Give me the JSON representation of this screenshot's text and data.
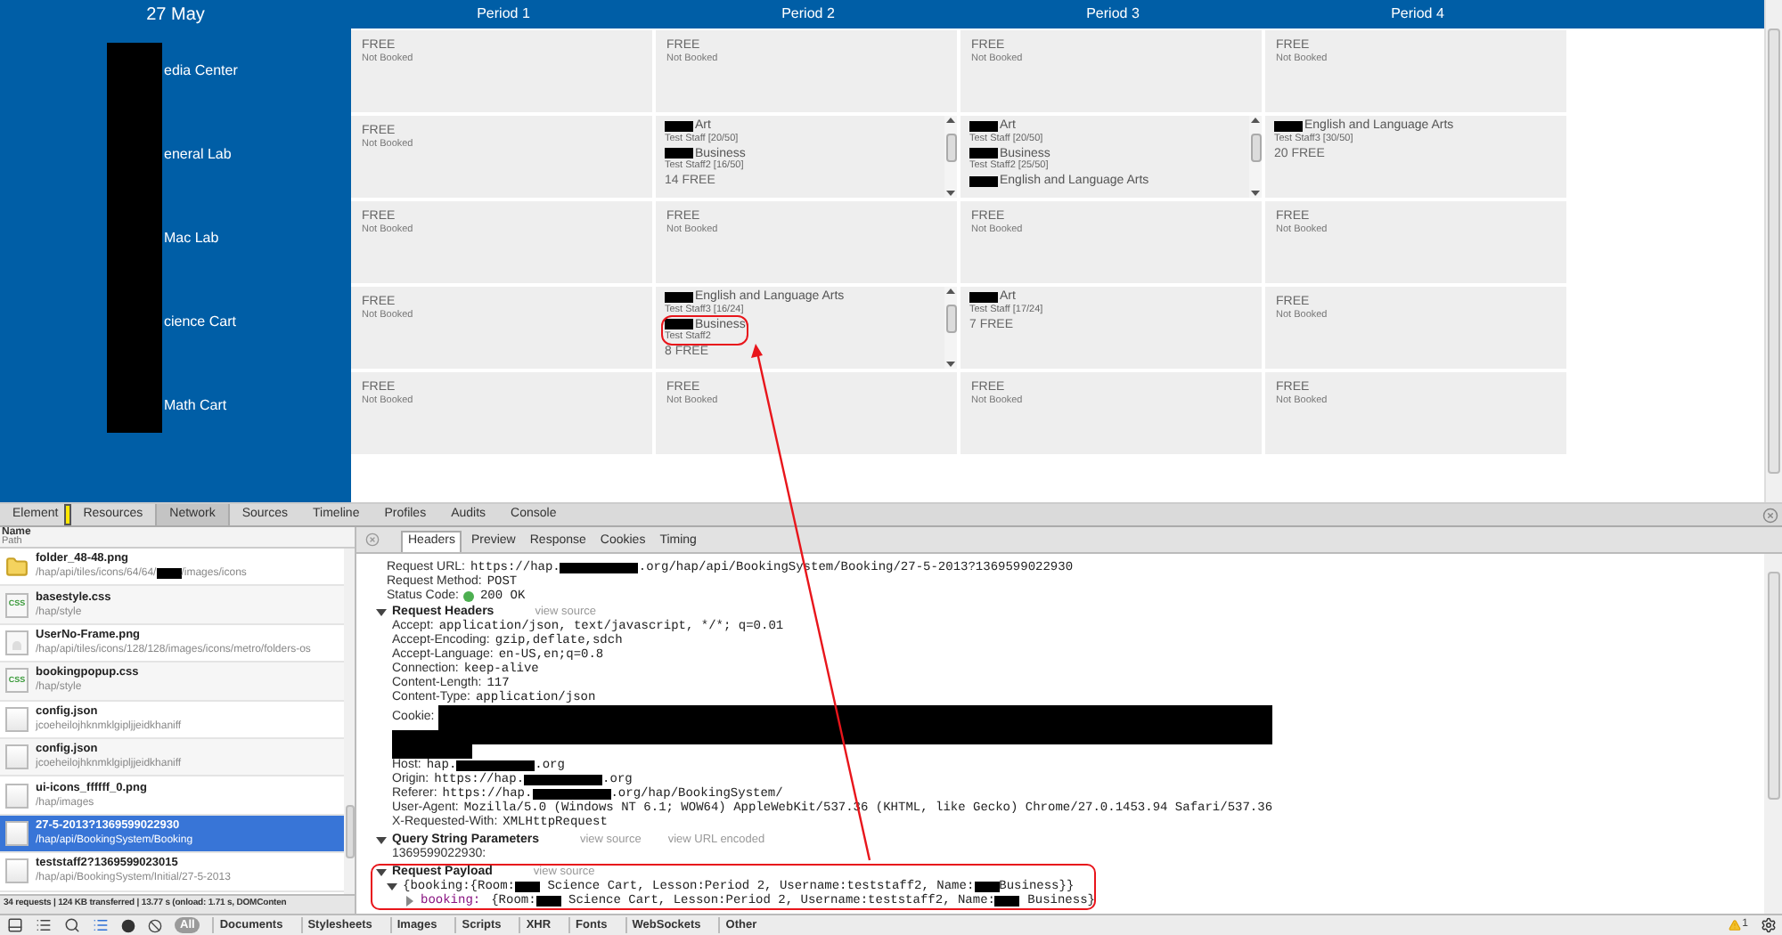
{
  "schedule": {
    "date": "27 May",
    "periods": [
      "Period 1",
      "Period 2",
      "Period 3",
      "Period 4"
    ],
    "rooms": [
      {
        "name": "edia Center",
        "cells": [
          {
            "kind": "free",
            "status": "FREE",
            "note": "Not Booked"
          },
          {
            "kind": "free",
            "status": "FREE",
            "note": "Not Booked"
          },
          {
            "kind": "free",
            "status": "FREE",
            "note": "Not Booked"
          },
          {
            "kind": "free",
            "status": "FREE",
            "note": "Not Booked"
          }
        ]
      },
      {
        "name": "eneral Lab",
        "cells": [
          {
            "kind": "free",
            "status": "FREE",
            "note": "Not Booked"
          },
          {
            "kind": "booked",
            "scrollable": true,
            "bookings": [
              {
                "subject": "Art",
                "staff": "Test Staff [20/50]",
                "highlighted": false
              },
              {
                "subject": "Business",
                "staff": "Test Staff2 [16/50]",
                "highlighted": false
              }
            ],
            "free": "14 FREE"
          },
          {
            "kind": "booked",
            "scrollable": true,
            "bookings": [
              {
                "subject": "Art",
                "staff": "Test Staff [20/50]",
                "highlighted": false
              },
              {
                "subject": "Business",
                "staff": "Test Staff2 [25/50]",
                "highlighted": false
              },
              {
                "subject": "English and Language Arts",
                "highlighted": false
              }
            ]
          },
          {
            "kind": "booked",
            "scrollable": false,
            "bookings": [
              {
                "subject": "English and Language Arts",
                "staff": "Test Staff3 [30/50]",
                "highlighted": false
              }
            ],
            "free": "20 FREE"
          }
        ]
      },
      {
        "name": "Mac Lab",
        "cells": [
          {
            "kind": "free",
            "status": "FREE",
            "note": "Not Booked"
          },
          {
            "kind": "free",
            "status": "FREE",
            "note": "Not Booked"
          },
          {
            "kind": "free",
            "status": "FREE",
            "note": "Not Booked"
          },
          {
            "kind": "free",
            "status": "FREE",
            "note": "Not Booked"
          }
        ]
      },
      {
        "name": "cience Cart",
        "cells": [
          {
            "kind": "free",
            "status": "FREE",
            "note": "Not Booked"
          },
          {
            "kind": "booked",
            "scrollable": true,
            "bookings": [
              {
                "subject": "English and Language Arts",
                "staff": "Test Staff3 [16/24]",
                "highlighted": false
              },
              {
                "subject": "Business",
                "staff": "Test Staff2",
                "highlighted": true
              }
            ],
            "free": "8 FREE"
          },
          {
            "kind": "booked",
            "scrollable": false,
            "bookings": [
              {
                "subject": "Art",
                "staff": "Test Staff [17/24]",
                "highlighted": false
              }
            ],
            "free": "7 FREE"
          },
          {
            "kind": "free",
            "status": "FREE",
            "note": "Not Booked"
          }
        ]
      },
      {
        "name": "Math Cart",
        "cells": [
          {
            "kind": "free",
            "status": "FREE",
            "note": "Not Booked"
          },
          {
            "kind": "free",
            "status": "FREE",
            "note": "Not Booked"
          },
          {
            "kind": "free",
            "status": "FREE",
            "note": "Not Booked"
          },
          {
            "kind": "free",
            "status": "FREE",
            "note": "Not Booked"
          }
        ]
      }
    ]
  },
  "devtools": {
    "tabs": [
      {
        "label": "Element",
        "selected": false
      },
      {
        "label": "Resources",
        "selected": false
      },
      {
        "label": "Network",
        "selected": true
      },
      {
        "label": "Sources",
        "selected": false
      },
      {
        "label": "Timeline",
        "selected": false
      },
      {
        "label": "Profiles",
        "selected": false
      },
      {
        "label": "Audits",
        "selected": false
      },
      {
        "label": "Console",
        "selected": false
      }
    ],
    "request_list": {
      "header": "Name",
      "subheader": "Path",
      "items": [
        {
          "name": "folder_48-48.png",
          "path_parts": [
            "/hap/api/tiles/icons/64/64/",
            "/images/icons"
          ],
          "kind": "folder",
          "selected": false
        },
        {
          "name": "basestyle.css",
          "path_parts": [
            "/hap/style"
          ],
          "kind": "css",
          "icon_text": "CSS",
          "selected": false
        },
        {
          "name": "UserNo-Frame.png",
          "path_parts": [
            "/hap/api/tiles/icons/128/128/images/icons/metro/folders-os"
          ],
          "kind": "image",
          "selected": false
        },
        {
          "name": "bookingpopup.css",
          "path_parts": [
            "/hap/style"
          ],
          "kind": "css",
          "icon_text": "CSS",
          "selected": false
        },
        {
          "name": "config.json",
          "path_parts": [
            "jcoeheilojhknmklgipljjeidkhaniff"
          ],
          "kind": "blank",
          "selected": false
        },
        {
          "name": "config.json",
          "path_parts": [
            "jcoeheilojhknmklgipljjeidkhaniff"
          ],
          "kind": "blank",
          "selected": false
        },
        {
          "name": "ui-icons_ffffff_0.png",
          "path_parts": [
            "/hap/images"
          ],
          "kind": "blank",
          "selected": false
        },
        {
          "name": "27-5-2013?1369599022930",
          "path_parts": [
            "/hap/api/BookingSystem/Booking"
          ],
          "kind": "blank",
          "selected": true
        },
        {
          "name": "teststaff2?1369599023015",
          "path_parts": [
            "/hap/api/BookingSystem/Initial/27-5-2013"
          ],
          "kind": "blank",
          "selected": false
        }
      ],
      "summary": "34 requests | 124 KB transferred | 13.77 s (onload: 1.71 s, DOMConten"
    },
    "filter_bar": {
      "filters": [
        {
          "label": "All",
          "selected": true
        },
        {
          "label": "Documents",
          "selected": false
        },
        {
          "label": "Stylesheets",
          "selected": false
        },
        {
          "label": "Images",
          "selected": false
        },
        {
          "label": "Scripts",
          "selected": false
        },
        {
          "label": "XHR",
          "selected": false
        },
        {
          "label": "Fonts",
          "selected": false
        },
        {
          "label": "WebSockets",
          "selected": false
        },
        {
          "label": "Other",
          "selected": false
        }
      ],
      "warnings": "1"
    },
    "detail": {
      "tabs": [
        {
          "label": "Headers",
          "selected": true
        },
        {
          "label": "Preview",
          "selected": false
        },
        {
          "label": "Response",
          "selected": false
        },
        {
          "label": "Cookies",
          "selected": false
        },
        {
          "label": "Timing",
          "selected": false
        }
      ],
      "general": [
        {
          "name": "Request URL:",
          "kind": "text",
          "parts": [
            "https://hap.",
            ".org/hap/api/BookingSystem/Booking/27-5-2013?1369599022930"
          ]
        },
        {
          "name": "Request Method:",
          "kind": "text",
          "parts": [
            "POST"
          ]
        },
        {
          "name": "Status Code:",
          "kind": "status",
          "parts": [
            "200 OK"
          ]
        }
      ],
      "sections": [
        {
          "title": "Request Headers",
          "expanded": true,
          "highlighted": false,
          "links": [
            "view source"
          ],
          "rows": [
            {
              "name": "Accept:",
              "kind": "text",
              "parts": [
                "application/json, text/javascript, */*; q=0.01"
              ]
            },
            {
              "name": "Accept-Encoding:",
              "kind": "text",
              "parts": [
                "gzip,deflate,sdch"
              ]
            },
            {
              "name": "Accept-Language:",
              "kind": "text",
              "parts": [
                "en-US,en;q=0.8"
              ]
            },
            {
              "name": "Connection:",
              "kind": "text",
              "parts": [
                "keep-alive"
              ]
            },
            {
              "name": "Content-Length:",
              "kind": "text",
              "parts": [
                "117"
              ]
            },
            {
              "name": "Content-Type:",
              "kind": "text",
              "parts": [
                "application/json"
              ]
            },
            {
              "name": "Cookie:",
              "kind": "redacted"
            },
            {
              "name": "Host:",
              "kind": "text",
              "parts": [
                "hap.",
                ".org"
              ]
            },
            {
              "name": "Origin:",
              "kind": "text",
              "parts": [
                "https://hap.",
                ".org"
              ]
            },
            {
              "name": "Referer:",
              "kind": "text",
              "parts": [
                "https://hap.",
                ".org/hap/BookingSystem/"
              ]
            },
            {
              "name": "User-Agent:",
              "kind": "text",
              "parts": [
                "Mozilla/5.0 (Windows NT 6.1; WOW64) AppleWebKit/537.36 (KHTML, like Gecko) Chrome/27.0.1453.94 Safari/537.36"
              ]
            },
            {
              "name": "X-Requested-With:",
              "kind": "text",
              "parts": [
                "XMLHttpRequest"
              ]
            }
          ]
        },
        {
          "title": "Query String Parameters",
          "expanded": true,
          "highlighted": false,
          "links": [
            "view source",
            "view URL encoded"
          ],
          "rows": [
            {
              "name": "1369599022930:",
              "kind": "text",
              "parts": []
            }
          ]
        },
        {
          "title": "Request Payload",
          "expanded": true,
          "highlighted": true,
          "links": [
            "view source"
          ],
          "tree": [
            {
              "expanded": true,
              "parts": [
                "{booking:{Room:",
                " Science Cart, Lesson:Period 2, Username:teststaff2, Name:",
                "Business}}"
              ],
              "children": [
                {
                  "expanded": false,
                  "key": "booking:",
                  "parts": [
                    "{Room:",
                    " Science Cart, Lesson:Period 2, Username:teststaff2, Name:",
                    " Business}"
                  ]
                }
              ]
            }
          ]
        }
      ]
    }
  }
}
